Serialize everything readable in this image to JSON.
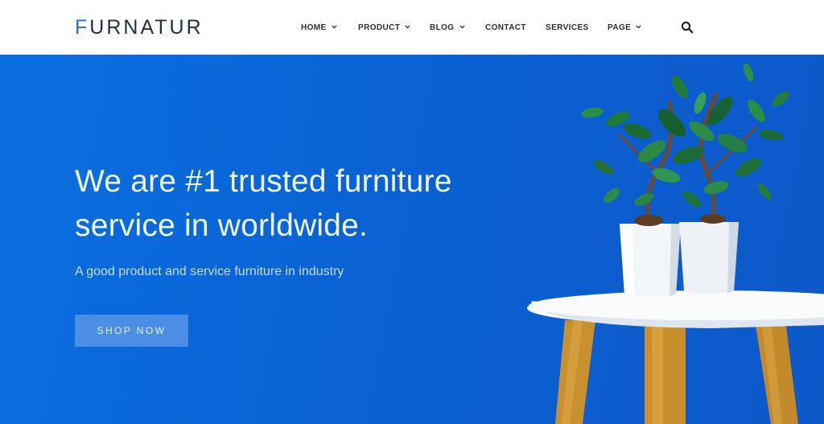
{
  "header": {
    "logo_first": "F",
    "logo_rest": "URNATUR",
    "nav": [
      {
        "label": "HOME",
        "has_dropdown": true
      },
      {
        "label": "PRODUCT",
        "has_dropdown": true
      },
      {
        "label": "BLOG",
        "has_dropdown": true
      },
      {
        "label": "CONTACT",
        "has_dropdown": false
      },
      {
        "label": "SERVICES",
        "has_dropdown": false
      },
      {
        "label": "PAGE",
        "has_dropdown": true
      }
    ],
    "search_icon": "search-icon"
  },
  "hero": {
    "title_line1": "We are #1 trusted furniture",
    "title_line2": "service in worldwide.",
    "subtitle": "A good product and service furniture in industry",
    "cta_label": "SHOP NOW",
    "image": "plant-pots-on-table"
  },
  "colors": {
    "brand": "#1f6fd6",
    "hero_bg": "#0a62d4",
    "button_bg": "#4a8ee6"
  }
}
